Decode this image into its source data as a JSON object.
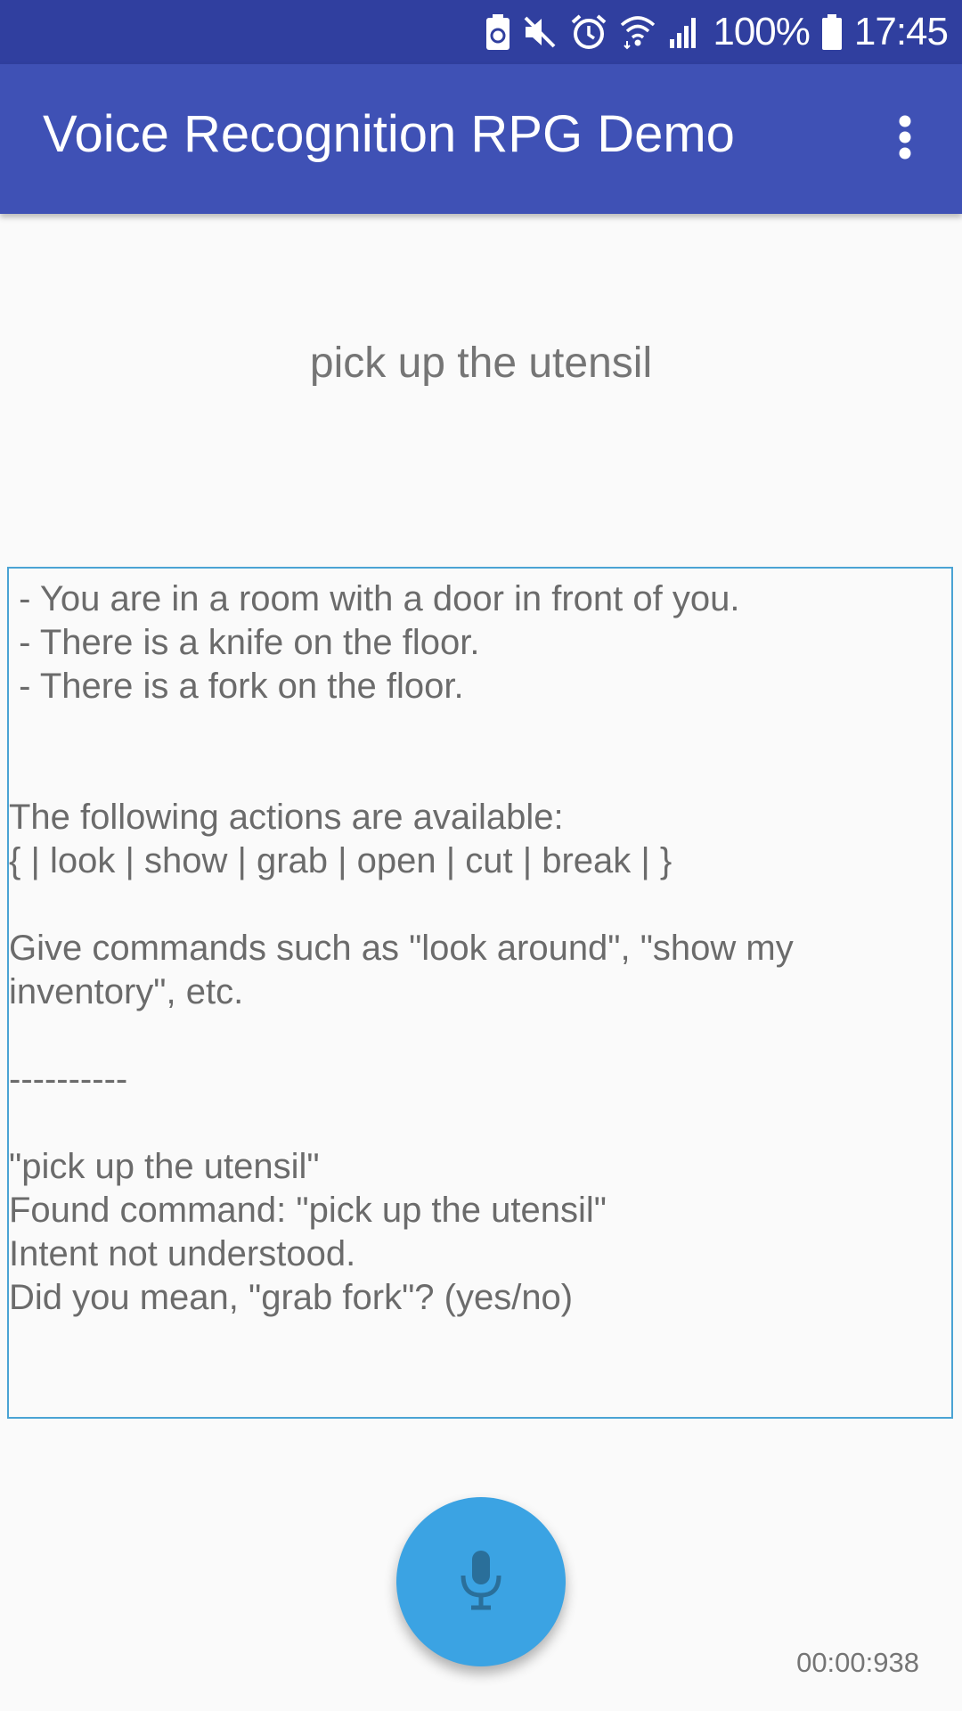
{
  "status_bar": {
    "battery_percent": "100%",
    "time": "17:45",
    "icons": [
      "battery-saver-icon",
      "mute-icon",
      "alarm-icon",
      "wifi-icon",
      "signal-icon",
      "battery-icon"
    ]
  },
  "app_bar": {
    "title": "Voice Recognition RPG Demo",
    "menu_icon": "more-vert-icon",
    "color": "#3f51b5"
  },
  "recognized_text": "pick up the utensil",
  "log": {
    "text": " - You are in a room with a door in front of you.\n - There is a knife on the floor.\n - There is a fork on the floor.\n\n\nThe following actions are available:\n{ | look | show | grab | open | cut | break | }\n\nGive commands such as \"look around\", \"show my inventory\", etc.\n\n----------\n\n\"pick up the utensil\"\nFound command: \"pick up the utensil\"\nIntent not understood.\nDid you mean, \"grab fork\"? (yes/no)"
  },
  "fab": {
    "icon": "microphone-icon",
    "color": "#3ba3e3"
  },
  "timer": "00:00:938"
}
